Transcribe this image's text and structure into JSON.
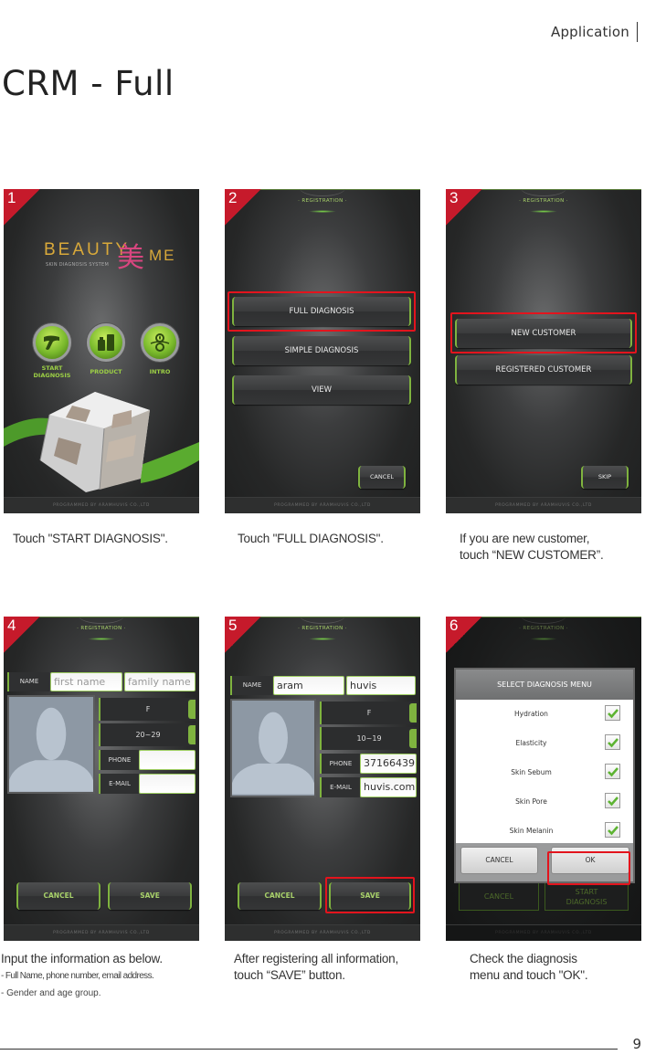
{
  "header": {
    "section": "Application",
    "title": "CRM -  Full"
  },
  "app": {
    "footer_text": "PROGRAMMED BY ARAMHUVIS CO.,LTD",
    "registration_label": "· REGISTRATION ·",
    "accent_color": "#7fb33f",
    "highlight_color": "#e3141d",
    "badge_color": "#c61a2b"
  },
  "steps": [
    {
      "number": "1",
      "caption": "Touch \"START DIAGNOSIS\".",
      "screen": {
        "logo_main": "BEAUTY",
        "logo_char": "美",
        "logo_suffix": "ME",
        "logo_subtitle": "SKIN DIAGNOSIS SYSTEM",
        "menu": [
          {
            "label": "START DIAGNOSIS",
            "icon": "handheld-scanner-icon"
          },
          {
            "label": "PRODUCT",
            "icon": "cosmetic-bottles-icon"
          },
          {
            "label": "INTRO",
            "icon": "skin-drop-icon"
          }
        ]
      }
    },
    {
      "number": "2",
      "caption": "Touch \"FULL DIAGNOSIS\".",
      "screen": {
        "buttons": [
          "FULL DIAGNOSIS",
          "SIMPLE DIAGNOSIS",
          "VIEW"
        ],
        "highlighted": "FULL DIAGNOSIS",
        "cancel": "CANCEL"
      }
    },
    {
      "number": "3",
      "caption_line1": "If you are new customer,",
      "caption_line2": "touch “NEW CUSTOMER”.",
      "screen": {
        "buttons": [
          "NEW CUSTOMER",
          "REGISTERED CUSTOMER"
        ],
        "highlighted": "NEW CUSTOMER",
        "skip": "SKIP"
      }
    },
    {
      "number": "4",
      "caption": "Input the information as below.",
      "notes": [
        "- Full Name, phone number, email address.",
        "- Gender and age group."
      ],
      "screen": {
        "name_label": "NAME",
        "first_name_placeholder": "first name",
        "family_name_placeholder": "family name",
        "gender": "F",
        "age_group": "20~29",
        "phone_label": "PHONE",
        "phone_value": "",
        "email_label": "E-MAIL",
        "email_value": "",
        "cancel": "CANCEL",
        "save": "SAVE"
      }
    },
    {
      "number": "5",
      "caption_line1": "After registering all information,",
      "caption_line2": "touch “SAVE” button.",
      "screen": {
        "name_label": "NAME",
        "first_name": "aram",
        "family_name": "huvis",
        "gender": "F",
        "age_group": "10~19",
        "phone_label": "PHONE",
        "phone_value": "37166439",
        "email_label": "E-MAIL",
        "email_value": "huvis.com",
        "cancel": "CANCEL",
        "save": "SAVE",
        "highlighted": "SAVE"
      }
    },
    {
      "number": "6",
      "caption_line1": "Check the diagnosis",
      "caption_line2": "menu and touch \"OK\".",
      "screen": {
        "dialog_title": "SELECT DIAGNOSIS MENU",
        "items": [
          {
            "label": "Hydration",
            "checked": true
          },
          {
            "label": "Elasticity",
            "checked": true
          },
          {
            "label": "Skin Sebum",
            "checked": true
          },
          {
            "label": "Skin Pore",
            "checked": true
          },
          {
            "label": "Skin Melanin",
            "checked": true
          }
        ],
        "dialog_cancel": "CANCEL",
        "dialog_ok": "OK",
        "highlighted": "OK",
        "bg_cancel": "CANCEL",
        "bg_start_line1": "START",
        "bg_start_line2": "DIAGNOSIS"
      }
    }
  ],
  "page_number": "9"
}
